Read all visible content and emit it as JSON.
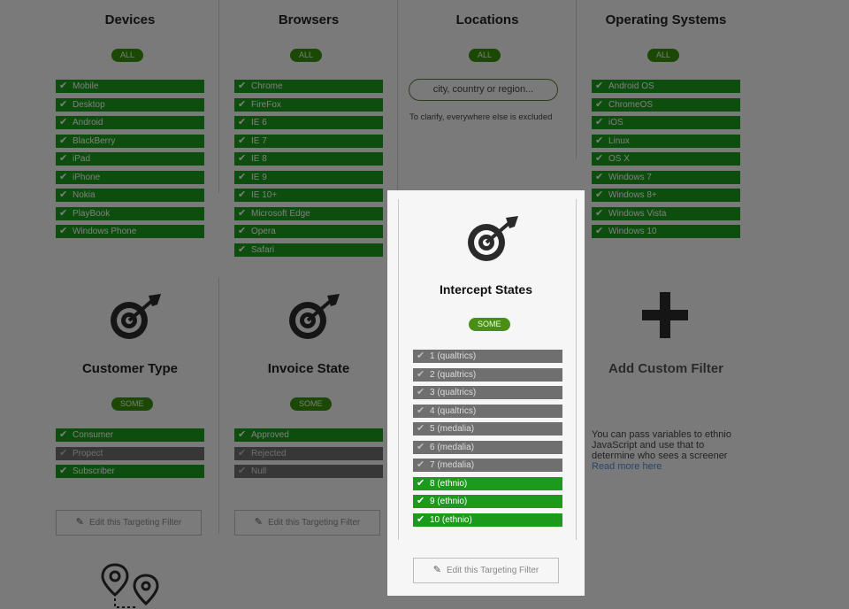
{
  "columns": {
    "devices": {
      "title": "Devices",
      "badge": "ALL",
      "items": [
        "Mobile",
        "Desktop",
        "Android",
        "BlackBerry",
        "iPad",
        "iPhone",
        "Nokia",
        "PlayBook",
        "Windows Phone"
      ]
    },
    "browsers": {
      "title": "Browsers",
      "badge": "ALL",
      "items": [
        "Chrome",
        "FireFox",
        "IE 6",
        "IE 7",
        "IE 8",
        "IE 9",
        "IE 10+",
        "Microsoft Edge",
        "Opera",
        "Safari"
      ]
    },
    "locations": {
      "title": "Locations",
      "badge": "ALL",
      "placeholder": "city, country or region...",
      "note": "To clarify, everywhere else is excluded"
    },
    "os": {
      "title": "Operating Systems",
      "badge": "ALL",
      "items": [
        "Android OS",
        "ChromeOS",
        "iOS",
        "Linux",
        "OS X",
        "Windows 7",
        "Windows 8+",
        "Windows Vista",
        "Windows 10"
      ]
    }
  },
  "customer_type": {
    "title": "Customer Type",
    "badge": "SOME",
    "items": [
      {
        "label": "Consumer",
        "checked": true
      },
      {
        "label": "Propect",
        "checked": false
      },
      {
        "label": "Subscriber",
        "checked": true
      }
    ],
    "edit": "Edit this Targeting Filter"
  },
  "invoice_state": {
    "title": "Invoice State",
    "badge": "SOME",
    "items": [
      {
        "label": "Approved",
        "checked": true
      },
      {
        "label": "Rejected",
        "checked": false
      },
      {
        "label": "Null",
        "checked": false
      }
    ],
    "edit": "Edit this Targeting Filter"
  },
  "intercept_states": {
    "title": "Intercept States",
    "badge": "SOME",
    "items": [
      {
        "label": "1 (qualtrics)",
        "checked": false
      },
      {
        "label": "2 (qualtrics)",
        "checked": false
      },
      {
        "label": "3 (qualtrics)",
        "checked": false
      },
      {
        "label": "4 (qualtrics)",
        "checked": false
      },
      {
        "label": "5 (medalia)",
        "checked": false
      },
      {
        "label": "6 (medalia)",
        "checked": false
      },
      {
        "label": "7 (medalia)",
        "checked": false
      },
      {
        "label": "8 (ethnio)",
        "checked": true
      },
      {
        "label": "9 (ethnio)",
        "checked": true
      },
      {
        "label": "10 (ethnio)",
        "checked": true
      }
    ],
    "edit": "Edit this Targeting Filter"
  },
  "custom": {
    "title": "Add Custom Filter",
    "info": "You can pass variables to ethnio JavaScript and use that to determine who sees a screener",
    "link": "Read more here"
  },
  "icons": {
    "target": "target-arrow-icon",
    "plus": "plus-icon",
    "pencil": "pencil-icon",
    "check": "check-icon",
    "route": "route-pins-icon"
  },
  "colors": {
    "checked": "#1b9a1b",
    "unchecked": "#6f6f6f",
    "badge": "#39900a",
    "link": "#4a8fd8"
  }
}
